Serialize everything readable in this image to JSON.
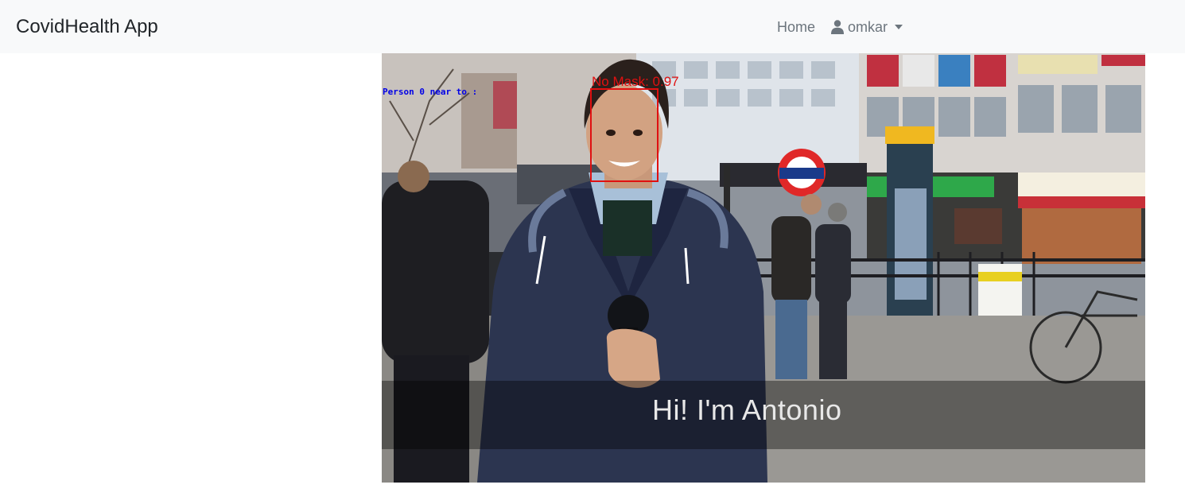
{
  "navbar": {
    "brand": "CovidHealth App",
    "home_label": "Home",
    "user_label": "omkar",
    "user_icon": "user-icon",
    "dropdown_icon": "caret-down-icon",
    "background": "#f8f9fa"
  },
  "video": {
    "overlay_person": "Person 0 near to :",
    "overlay_mask": "No Mask: 0.97",
    "subtitle": "Hi! I'm Antonio",
    "detection_color": "#e01010",
    "person_label_color": "#0000e6"
  }
}
